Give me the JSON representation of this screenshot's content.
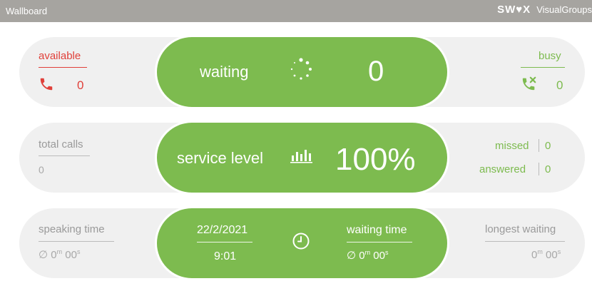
{
  "header": {
    "title": "Wallboard",
    "brand_logo": "SW♥X",
    "brand_name": "VisualGroups"
  },
  "row1": {
    "available": {
      "label": "available",
      "value": "0",
      "icon": "phone-icon",
      "color": "#e0403a"
    },
    "waiting": {
      "label": "waiting",
      "value": "0",
      "icon": "spinner-icon"
    },
    "busy": {
      "label": "busy",
      "value": "0",
      "icon": "phone-busy-icon",
      "color": "#7dbb4f"
    }
  },
  "row2": {
    "total_calls": {
      "label": "total calls",
      "value": "0"
    },
    "service_level": {
      "label": "service level",
      "value": "100%",
      "icon": "bar-chart-icon"
    },
    "missed": {
      "label": "missed",
      "value": "0"
    },
    "answered": {
      "label": "answered",
      "value": "0"
    }
  },
  "row3": {
    "speaking_time": {
      "label": "speaking time",
      "symbol": "∅",
      "minutes": "0",
      "m_unit": "m",
      "seconds": "00",
      "s_unit": "s"
    },
    "date": "22/2/2021",
    "time": "9:01",
    "clock_icon": "clock-icon",
    "waiting_time": {
      "label": "waiting time",
      "symbol": "∅",
      "minutes": "0",
      "m_unit": "m",
      "seconds": "00",
      "s_unit": "s"
    },
    "longest_waiting": {
      "label": "longest waiting",
      "minutes": "0",
      "m_unit": "m",
      "seconds": "00",
      "s_unit": "s"
    }
  },
  "colors": {
    "green": "#7dbb4f",
    "red": "#e0403a",
    "topbar": "#a6a4a0",
    "panel": "#f0f0f0"
  }
}
